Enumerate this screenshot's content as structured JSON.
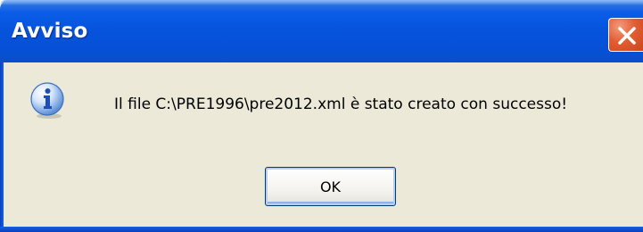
{
  "window": {
    "title": "Avviso"
  },
  "dialog": {
    "icon": "info-icon",
    "message": "Il file C:\\PRE1996\\pre2012.xml è stato creato con successo!",
    "ok_label": "OK"
  },
  "colors": {
    "titlebar": "#0653dc",
    "dialog_background": "#ece9d8",
    "close_button": "#e35d33"
  }
}
